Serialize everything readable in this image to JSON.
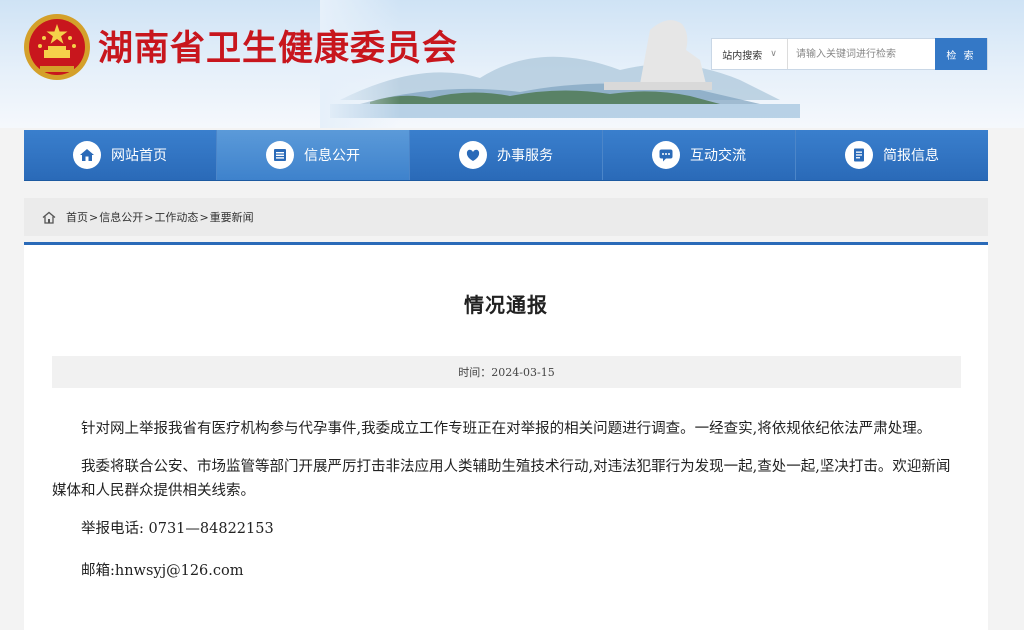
{
  "site": {
    "title": "湖南省卫生健康委员会"
  },
  "search": {
    "scope_label": "站内搜索",
    "placeholder": "请输入关键词进行检索",
    "button_label": "检 索"
  },
  "nav": {
    "items": [
      {
        "label": "网站首页",
        "icon": "home-icon"
      },
      {
        "label": "信息公开",
        "icon": "document-list-icon"
      },
      {
        "label": "办事服务",
        "icon": "service-hands-icon"
      },
      {
        "label": "互动交流",
        "icon": "chat-bubble-icon"
      },
      {
        "label": "简报信息",
        "icon": "bulletin-icon"
      }
    ],
    "active_index": 1
  },
  "breadcrumb": {
    "items": [
      "首页",
      "信息公开",
      "工作动态",
      "重要新闻"
    ],
    "separator": ">"
  },
  "article": {
    "title": "情况通报",
    "time_label": "时间：2024-03-15",
    "paragraphs": [
      "针对网上举报我省有医疗机构参与代孕事件,我委成立工作专班正在对举报的相关问题进行调查。一经查实,将依规依纪依法严肃处理。",
      "我委将联合公安、市场监管等部门开展严厉打击非法应用人类辅助生殖技术行动,对违法犯罪行为发现一起,查处一起,坚决打击。欢迎新闻媒体和人民群众提供相关线索。",
      "举报电话: 0731—84822153",
      "邮箱:hnwsyj@126.com"
    ]
  },
  "colors": {
    "brand_red": "#c8161d",
    "nav_blue": "#2a6ab8",
    "search_blue": "#3478c6"
  }
}
